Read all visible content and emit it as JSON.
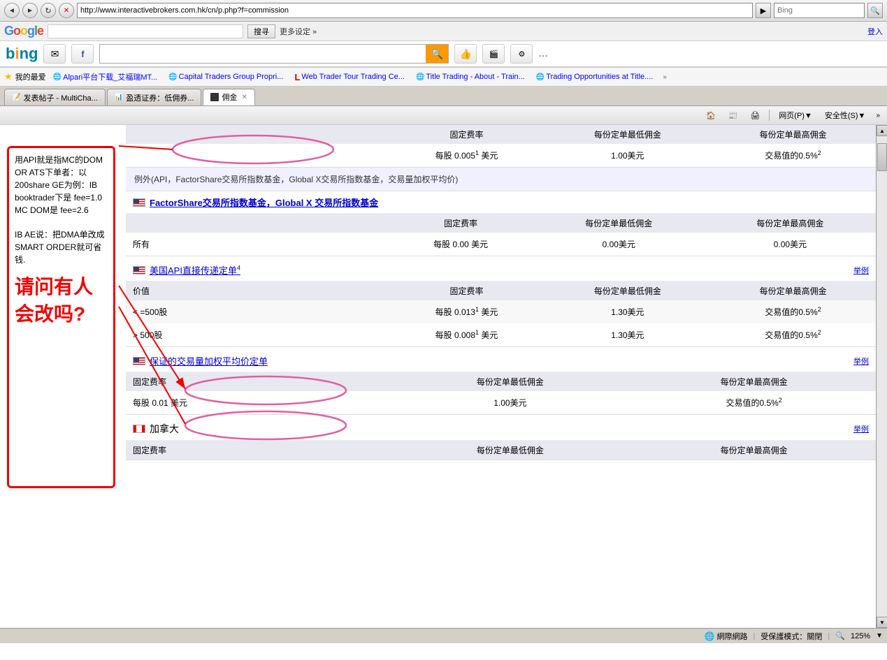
{
  "browser": {
    "address": "http://www.interactivebrokers.com.hk/cn/p.php?f=commission",
    "bing_search": "Bing",
    "back_title": "后退",
    "forward_title": "前进",
    "refresh_title": "刷新",
    "stop_title": "停止"
  },
  "google_bar": {
    "logo": "Google",
    "search_placeholder": "",
    "search_btn": "搜寻",
    "more_settings": "更多设定 »",
    "login": "登入"
  },
  "bing_bar": {
    "logo": "bing",
    "more": "..."
  },
  "favorites": {
    "label": "我的最爱",
    "items": [
      {
        "label": "Alpari平台下载_艾福瑞MT...",
        "icon": "globe"
      },
      {
        "label": "Capital Traders Group  Propri...",
        "icon": "globe"
      },
      {
        "label": "Web Trader Tour Trading Ce...",
        "icon": "red-l"
      },
      {
        "label": "Title Trading - About - Train...",
        "icon": "globe"
      },
      {
        "label": "Trading Opportunities at Title....",
        "icon": "globe"
      }
    ],
    "expand": "»"
  },
  "tabs": [
    {
      "label": "发表帖子 - MultiCha...",
      "active": false,
      "closable": false
    },
    {
      "label": "盈透证券：低佣券...",
      "active": false,
      "closable": false
    },
    {
      "label": "佣金",
      "active": true,
      "closable": true
    }
  ],
  "ie_commands": {
    "home": "🏠",
    "feeds": "📰",
    "print": "🖨",
    "page": "网页(P)▼",
    "safety": "安全性(S)▼"
  },
  "content": {
    "top_section": {
      "col1": "固定费率",
      "col2": "每份定单最低佣金",
      "col3": "每份定单最高佣金",
      "row1": {
        "label": "",
        "rate": "每股 0.005",
        "superscript": "1",
        "unit": "美元",
        "min": "1.00美元",
        "max": "交易值的0.5%",
        "max_super": "2"
      }
    },
    "exception_section": {
      "text": "例外(API，FactorShare交易所指数基金，Global X交易所指数基金，交易量加权平均价)"
    },
    "factorshare": {
      "title": "FactorShare交易所指数基金，Global X 交易所指数基金",
      "col1": "固定费率",
      "col2": "每份定单最低佣金",
      "col3": "每份定单最高佣金",
      "row1": {
        "label": "所有",
        "rate": "每股 0.00",
        "unit": "美元",
        "min": "0.00美元",
        "max": "0.00美元"
      }
    },
    "api_section": {
      "title": "美国API直接传递定单",
      "title_super": "4",
      "sample": "举例",
      "col1": "价值",
      "col2": "固定费率",
      "col3": "每份定单最低佣金",
      "col4": "每份定单最高佣金",
      "row1": {
        "label": "< =500股",
        "rate": "每股 0.013",
        "superscript": "1",
        "unit": "美元",
        "min": "1.30美元",
        "max": "交易值的0.5%",
        "max_super": "2"
      },
      "row2": {
        "label": "> 500股",
        "rate": "每股 0.008",
        "superscript": "1",
        "unit": "美元",
        "min": "1.30美元",
        "max": "交易值的0.5%",
        "max_super": "2"
      }
    },
    "vwap_section": {
      "title": "保证的交易量加权平均价定单",
      "sample": "举例",
      "col1": "固定费率",
      "col2": "每份定单最低佣金",
      "col3": "每份定单最高佣金",
      "row1": {
        "rate": "每股 0.01",
        "unit": "美元",
        "min": "1.00美元",
        "max": "交易值的0.5%",
        "max_super": "2"
      }
    },
    "canada_section": {
      "title": "加拿大",
      "sample": "举例",
      "col1": "固定费率",
      "col2": "每份定单最低佣金",
      "col3": "每份定单最高佣金"
    }
  },
  "annotation": {
    "text1": "用API就是指MC的DOM OR ATS下单者：以200share GE为例：IB booktrader下是 fee=1.0 MC DOM是 fee=2.6",
    "text2": "IB AE说：把DMA单改成SMART ORDER就可省钱.",
    "text3": "请问有人会改吗?"
  },
  "status_bar": {
    "network": "網際網路",
    "protected_mode": "受保護模式：關閉",
    "zoom": "125%"
  }
}
